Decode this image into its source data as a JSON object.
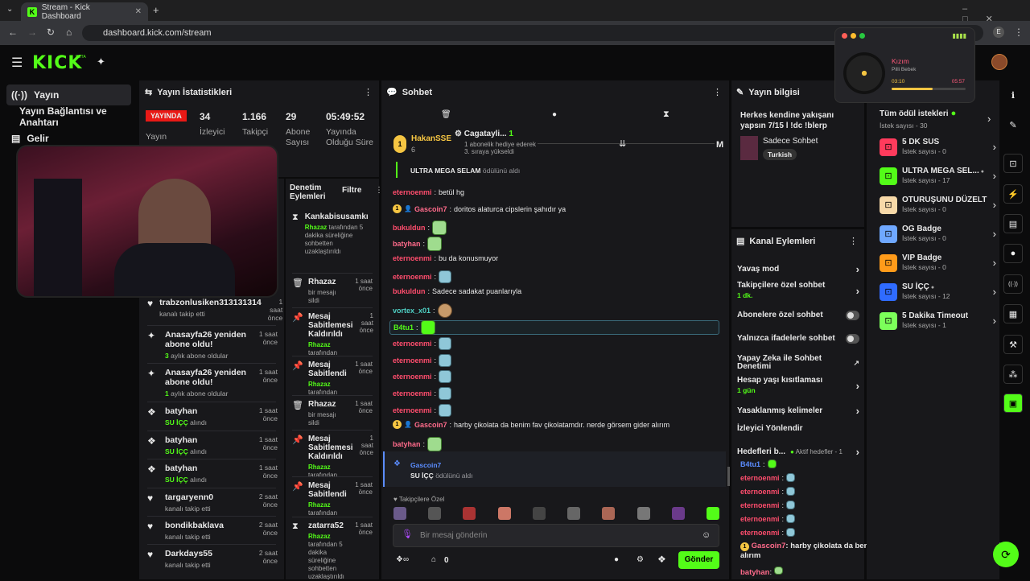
{
  "browser": {
    "tab_title": "Stream - Kick Dashboard",
    "url": "dashboard.kick.com/stream",
    "profile_initial": "E"
  },
  "brand": {
    "logo": "KICK",
    "beta": "BETA"
  },
  "sidebar": {
    "items": [
      {
        "label": "Yayın",
        "icon": "broadcast-icon"
      },
      {
        "label": "Yayın Bağlantısı ve Anahtarı",
        "icon": "key-icon"
      },
      {
        "label": "Gelir",
        "icon": "chart-icon"
      }
    ]
  },
  "stats_panel": {
    "title": "Yayın İstatistikleri",
    "live_badge": "YAYINDA",
    "live_sub": "Yayın",
    "stats": [
      {
        "value": "34",
        "label": "İzleyici"
      },
      {
        "value": "1.166",
        "label": "Takipçi"
      },
      {
        "value": "29",
        "label": "Abone Sayısı"
      },
      {
        "value": "05:49:52",
        "label": "Yayında Olduğu Süre"
      }
    ]
  },
  "activity_feed": [
    {
      "icon": "heart-icon",
      "title": "trabzonlusiken313131314",
      "sub": "kanalı takip etti",
      "time": "1 saat önce"
    },
    {
      "icon": "sparkle-icon",
      "title": "Anasayfa26 yeniden abone oldu!",
      "sub_highlight": "3",
      "sub": "aylık abone oldular",
      "time": "1 saat önce"
    },
    {
      "icon": "sparkle-icon",
      "title": "Anasayfa26 yeniden abone oldu!",
      "sub_highlight": "1",
      "sub": "aylık abone oldular",
      "time": "1 saat önce"
    },
    {
      "icon": "reward-icon",
      "title": "batyhan",
      "sub_highlight": "SU İÇÇ",
      "sub": "alındı",
      "time": "1 saat önce"
    },
    {
      "icon": "reward-icon",
      "title": "batyhan",
      "sub_highlight": "SU İÇÇ",
      "sub": "alındı",
      "time": "1 saat önce"
    },
    {
      "icon": "reward-icon",
      "title": "batyhan",
      "sub_highlight": "SU İÇÇ",
      "sub": "alındı",
      "time": "1 saat önce"
    },
    {
      "icon": "heart-icon",
      "title": "targaryenn0",
      "sub": "kanalı takip etti",
      "time": "2 saat önce"
    },
    {
      "icon": "heart-icon",
      "title": "bondikbaklava",
      "sub": "kanalı takip etti",
      "time": "2 saat önce"
    },
    {
      "icon": "heart-icon",
      "title": "Darkdays55",
      "sub": "kanalı takip etti",
      "time": "2 saat önce"
    }
  ],
  "moderation": {
    "title": "Denetim Eylemleri",
    "filter": "Filtre",
    "items": [
      {
        "icon": "hourglass-icon",
        "title": "Kankabisusamkı",
        "by": "Rhazaz",
        "sub": "tarafından 5 dakika süreliğine sohbetten uzaklaştırıldı",
        "time": ""
      },
      {
        "icon": "trash-icon",
        "title": "Rhazaz",
        "sub": "bir mesajı sildi",
        "time": "1 saat önce"
      },
      {
        "icon": "pin-icon",
        "title": "Mesaj Sabitlemesi Kaldırıldı",
        "by": "Rhazaz",
        "sub": "tarafından",
        "time": "1 saat önce"
      },
      {
        "icon": "pin-icon",
        "title": "Mesaj Sabitlendi",
        "by": "Rhazaz",
        "sub": "tarafından",
        "time": "1 saat önce"
      },
      {
        "icon": "trash-icon",
        "title": "Rhazaz",
        "sub": "bir mesajı sildi",
        "time": "1 saat önce"
      },
      {
        "icon": "pin-icon",
        "title": "Mesaj Sabitlemesi Kaldırıldı",
        "by": "Rhazaz",
        "sub": "tarafından",
        "time": "1 saat önce"
      },
      {
        "icon": "pin-icon",
        "title": "Mesaj Sabitlendi",
        "by": "Rhazaz",
        "sub": "tarafından",
        "time": "1 saat önce"
      },
      {
        "icon": "hourglass-icon",
        "title": "zatarra52",
        "by": "Rhazaz",
        "sub": "tarafından 5 dakika süreliğine sohbetten uzaklaştırıldı",
        "time": "1 saat önce"
      }
    ]
  },
  "chat": {
    "title": "Sohbet",
    "top_user": "HakanSSE",
    "top_count": "6",
    "top_user2": "Cagatayli...",
    "top_user2_info": "1 abonelik hediye ederek 3. sıraya yükseldi",
    "top_user2_badge": "1",
    "letter": "M",
    "redeem_text": "ULTRA MEGA SELAM",
    "redeem_suffix": "ödülünü aldı",
    "messages": [
      {
        "user": "eternoenmi",
        "text": "betül hg",
        "cls": "nm-red"
      },
      {
        "user": "Gascoin7",
        "text": "doritos alaturca cipslerin şahıdır ya",
        "cls": "nm-pink",
        "badge": "1"
      },
      {
        "user": "bukuldun",
        "text": "",
        "cls": "nm-red",
        "emote": true
      },
      {
        "user": "batyhan",
        "text": "",
        "cls": "nm-pink",
        "emote": true
      },
      {
        "user": "eternoenmi",
        "text": "bu da konusmuyor",
        "cls": "nm-red"
      },
      {
        "user": "eternoenmi",
        "text": "",
        "cls": "nm-red",
        "emote": true
      },
      {
        "user": "bukuldun",
        "text": "Sadece sadakat puanlarıyla",
        "cls": "nm-red"
      },
      {
        "user": "vortex_x01",
        "text": "",
        "cls": "nm-teal",
        "emote": true
      },
      {
        "user": "B4tu1",
        "text": "",
        "cls": "nm-green",
        "emote": true
      },
      {
        "user": "eternoenmi",
        "text": "",
        "cls": "nm-red",
        "emote": true
      },
      {
        "user": "eternoenmi",
        "text": "",
        "cls": "nm-red",
        "emote": true
      },
      {
        "user": "eternoenmi",
        "text": "",
        "cls": "nm-red",
        "emote": true
      },
      {
        "user": "eternoenmi",
        "text": "",
        "cls": "nm-red",
        "emote": true
      },
      {
        "user": "eternoenmi",
        "text": "",
        "cls": "nm-red",
        "emote": true
      },
      {
        "user": "Gascoin7",
        "text": "harby çikolata da benim fav çikolatamdır. nerde görsem gider alırım",
        "cls": "nm-pink",
        "badge": "1"
      },
      {
        "user": "batyhan",
        "text": "",
        "cls": "nm-pink",
        "emote": true
      }
    ],
    "last_redeem_user": "Gascoin7",
    "last_redeem_item": "SU İÇÇ",
    "last_redeem_suffix": "ödülünü aldı",
    "followers_only": "Takipçilere Özel",
    "input_placeholder": "Bir mesaj gönderin",
    "points": "0",
    "send": "Gönder"
  },
  "stream_info": {
    "title": "Yayın bilgisi",
    "stream_title": "Herkes kendine yakışanı yapsın 7/15 l !dc !blerp",
    "category": "Sadece Sohbet",
    "tag": "Turkish"
  },
  "channel_actions": {
    "title": "Kanal Eylemleri",
    "rows": [
      {
        "label": "Yavaş mod",
        "type": "chev"
      },
      {
        "label": "Takipçilere özel sohbet",
        "sub": "1 dk.",
        "type": "chev"
      },
      {
        "label": "Abonelere özel sohbet",
        "type": "toggle"
      },
      {
        "label": "Yalnızca ifadelerle sohbet",
        "type": "toggle"
      },
      {
        "label": "Yapay Zeka ile Sohbet Denetimi",
        "type": "ext"
      },
      {
        "label": "Hesap yaşı kısıtlaması",
        "sub": "1 gün",
        "type": "chev"
      },
      {
        "label": "Yasaklanmış kelimeler",
        "type": "chev"
      },
      {
        "label": "İzleyici Yönlendir",
        "type": "none"
      }
    ],
    "goals_label": "Hedefleri b...",
    "goals_sub": "Aktif hedefler - 1"
  },
  "mini_chat": [
    {
      "user": "B4tu1",
      "cls": "nm-blue"
    },
    {
      "user": "eternoenmi",
      "cls": "nm-red"
    },
    {
      "user": "eternoenmi",
      "cls": "nm-red"
    },
    {
      "user": "eternoenmi",
      "cls": "nm-red"
    },
    {
      "user": "eternoenmi",
      "cls": "nm-red"
    },
    {
      "user": "eternoenmi",
      "cls": "nm-red"
    }
  ],
  "mini_chat_last": {
    "user": "Gascoin7",
    "text": "harby çikolata da benim fav çikolatamdır. nerde görsem gider alırım"
  },
  "mini_chat_final": "batyhan",
  "rewards": {
    "all_label": "Tüm ödül istekleri",
    "all_sub": "İstek sayısı - 30",
    "items": [
      {
        "name": "5 DK SUS",
        "sub": "İstek sayısı - 0",
        "color": "#ff3b5c",
        "dot": false
      },
      {
        "name": "ULTRA MEGA SEL...",
        "sub": "İstek sayısı - 17",
        "color": "#53fc18",
        "dot": true
      },
      {
        "name": "OTURUŞUNU DÜZELT",
        "sub": "İstek sayısı - 0",
        "color": "#f7d9a8",
        "dot": false
      },
      {
        "name": "OG Badge",
        "sub": "İstek sayısı - 0",
        "color": "#6fa8ff",
        "dot": false
      },
      {
        "name": "VIP Badge",
        "sub": "İstek sayısı - 0",
        "color": "#ff9b1a",
        "dot": false
      },
      {
        "name": "SU İÇÇ",
        "sub": "İstek sayısı - 12",
        "color": "#2f6bff",
        "dot": true
      },
      {
        "name": "5 Dakika Timeout",
        "sub": "İstek sayısı - 1",
        "color": "#7cff5a",
        "dot": false
      }
    ]
  },
  "music": {
    "title": "Kızım",
    "artist": "Pilli Bebek",
    "elapsed": "03:10",
    "total": "05:57",
    "progress": 0.55
  },
  "colors": {
    "accent": "#53fc18",
    "live": "#e91916",
    "panel": "#18181b"
  }
}
